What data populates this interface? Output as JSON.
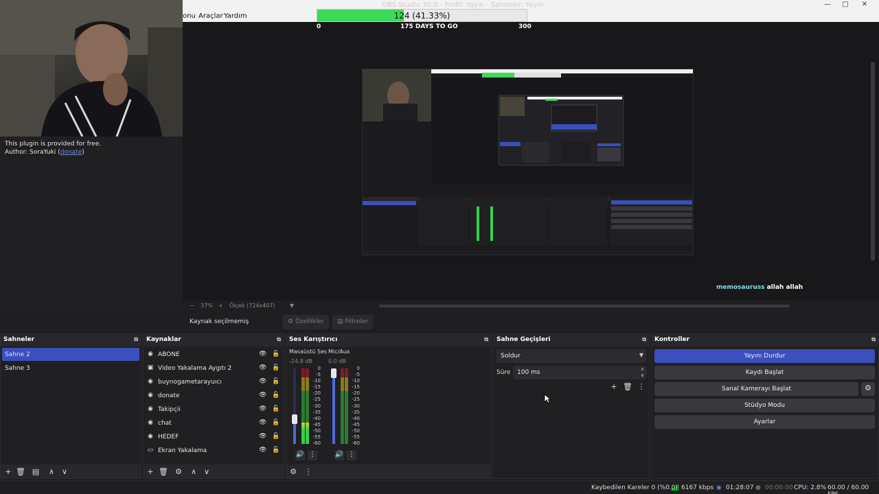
{
  "window": {
    "title": "OBS Studio 30.0 - Profil: Yayın - Sahneler: Yayın",
    "minimize": "—",
    "maximize": "□",
    "close": "✕"
  },
  "menu": {
    "items": [
      "onu",
      "Araçlar",
      "Yardım"
    ]
  },
  "goal": {
    "text": "124 (41.33%)",
    "progress": 0.4133,
    "min": "0",
    "max": "300",
    "days_left": "175 DAYS TO GO"
  },
  "plugin": {
    "line1": "This plugin is provided for free.",
    "author_prefix": "Author: SoraYuki (",
    "link": "donate",
    "author_suffix": ")"
  },
  "chat": {
    "user": "memosauruss",
    "text": "allah allah"
  },
  "zoom": {
    "minus": "−",
    "percent": "37%",
    "plus": "+",
    "scale": "Ölçek (724x407)"
  },
  "props": {
    "no_source": "Kaynak seçilmemiş",
    "properties": "Özellikler",
    "filters": "Filtreler"
  },
  "docks": {
    "scenes": {
      "title": "Sahneler",
      "items": [
        "Sahne 2",
        "Sahne 3"
      ],
      "active": 0
    },
    "sources": {
      "title": "Kaynaklar",
      "items": [
        {
          "name": "ABONE",
          "icon": "browser-icon"
        },
        {
          "name": "Video Yakalama Aygıtı 2",
          "icon": "camera-icon"
        },
        {
          "name": "buynogametarayuıcı",
          "icon": "browser-icon"
        },
        {
          "name": "donate",
          "icon": "browser-icon"
        },
        {
          "name": "Takipçii",
          "icon": "browser-icon"
        },
        {
          "name": "chat",
          "icon": "browser-icon"
        },
        {
          "name": "HEDEF",
          "icon": "browser-icon"
        },
        {
          "name": "Ekran Yakalama",
          "icon": "monitor-icon"
        }
      ]
    },
    "mixer": {
      "title": "Ses Karıştırıcı",
      "channels": [
        {
          "name": "Masaüstü Ses",
          "db": "-24.8 dB",
          "level": 0.28,
          "fader": 0.3
        },
        {
          "name": "Mic/Aux",
          "db": "0.0 dB",
          "level": 0.0,
          "fader": 1.0
        }
      ],
      "scale": [
        "0",
        "-5",
        "-10",
        "-15",
        "-20",
        "-25",
        "-30",
        "-35",
        "-40",
        "-45",
        "-50",
        "-55",
        "-60"
      ]
    },
    "transitions": {
      "title": "Sahne Geçişleri",
      "selected": "Soldur",
      "duration_label": "Süre",
      "duration": "100 ms"
    },
    "controls": {
      "title": "Kontroller",
      "stop_stream": "Yayını Durdur",
      "start_record": "Kaydı Başlat",
      "virtual_cam": "Sanal Kamerayı Başlat",
      "studio_mode": "Stüdyo Modu",
      "settings": "Ayarlar"
    }
  },
  "status": {
    "dropped": "Kaybedilen Kareler 0 (%0.0)",
    "bitrate": "6167 kbps",
    "stream_time": "01:28:07",
    "record_time": "00:00:00",
    "cpu": "CPU: 2.8%",
    "fps": "60.00 / 60.00 FPS"
  },
  "colors": {
    "accent": "#3b4fbd",
    "goal_fill": "#3cd957",
    "meter_green": "#36d04a",
    "chat_user": "#7fe0e0"
  }
}
